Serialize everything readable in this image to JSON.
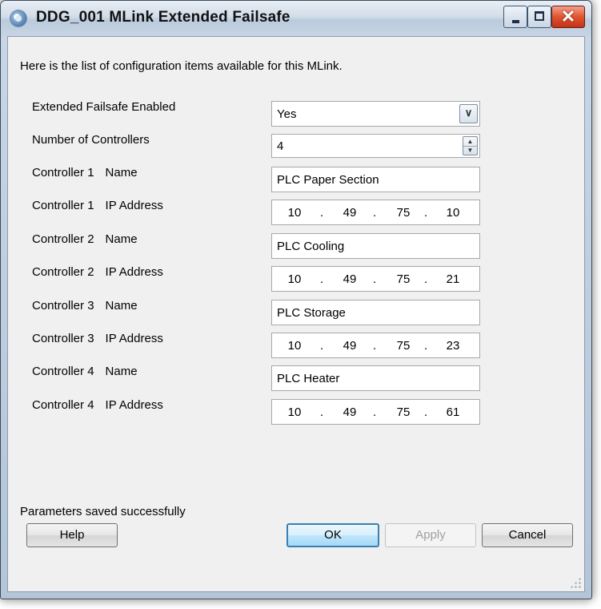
{
  "window": {
    "title": "DDG_001 MLink Extended Failsafe",
    "minimize_icon": "minimize-icon",
    "maximize_icon": "maximize-icon",
    "close_glyph": "✕"
  },
  "intro": "Here is the list of configuration items available for this MLink.",
  "settings": {
    "failsafe": {
      "label": "Extended Failsafe Enabled",
      "value": "Yes"
    },
    "controllers_count": {
      "label": "Number of Controllers",
      "value": "4"
    }
  },
  "controllers": [
    {
      "prefix": "Controller 1",
      "name_suffix": "Name",
      "ip_suffix": "IP Address",
      "name": "PLC Paper Section",
      "ip": [
        "10",
        "49",
        "75",
        "10"
      ]
    },
    {
      "prefix": "Controller 2",
      "name_suffix": "Name",
      "ip_suffix": "IP Address",
      "name": "PLC Cooling",
      "ip": [
        "10",
        "49",
        "75",
        "21"
      ]
    },
    {
      "prefix": "Controller 3",
      "name_suffix": "Name",
      "ip_suffix": "IP Address",
      "name": "PLC Storage",
      "ip": [
        "10",
        "49",
        "75",
        "23"
      ]
    },
    {
      "prefix": "Controller 4",
      "name_suffix": "Name",
      "ip_suffix": "IP Address",
      "name": "PLC Heater",
      "ip": [
        "10",
        "49",
        "75",
        "61"
      ]
    }
  ],
  "ip_separator": ".",
  "status": "Parameters saved successfully",
  "buttons": {
    "help": "Help",
    "ok": "OK",
    "apply": "Apply",
    "cancel": "Cancel"
  }
}
